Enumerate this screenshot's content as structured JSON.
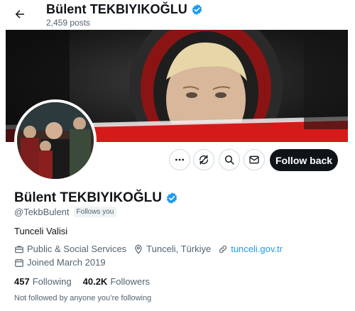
{
  "header": {
    "name": "Bülent TEKBIYIKOĞLU",
    "posts_count": "2,459 posts"
  },
  "profile": {
    "name": "Bülent TEKBIYIKOĞLU",
    "handle": "@TekbBulent",
    "follows_you": "Follows you",
    "bio": "Tunceli Valisi",
    "category": "Public & Social Services",
    "location": "Tunceli, Türkiye",
    "website": "tunceli.gov.tr",
    "joined": "Joined March 2019",
    "following_count": "457",
    "following_label": "Following",
    "followers_count": "40.2K",
    "followers_label": "Followers",
    "not_followed": "Not followed by anyone you’re following"
  },
  "actions": {
    "follow_label": "Follow back"
  },
  "colors": {
    "verified": "#1d9bf0",
    "link": "#1d9bf0",
    "follow_button": "#0f1419",
    "secondary_text": "#536471"
  }
}
